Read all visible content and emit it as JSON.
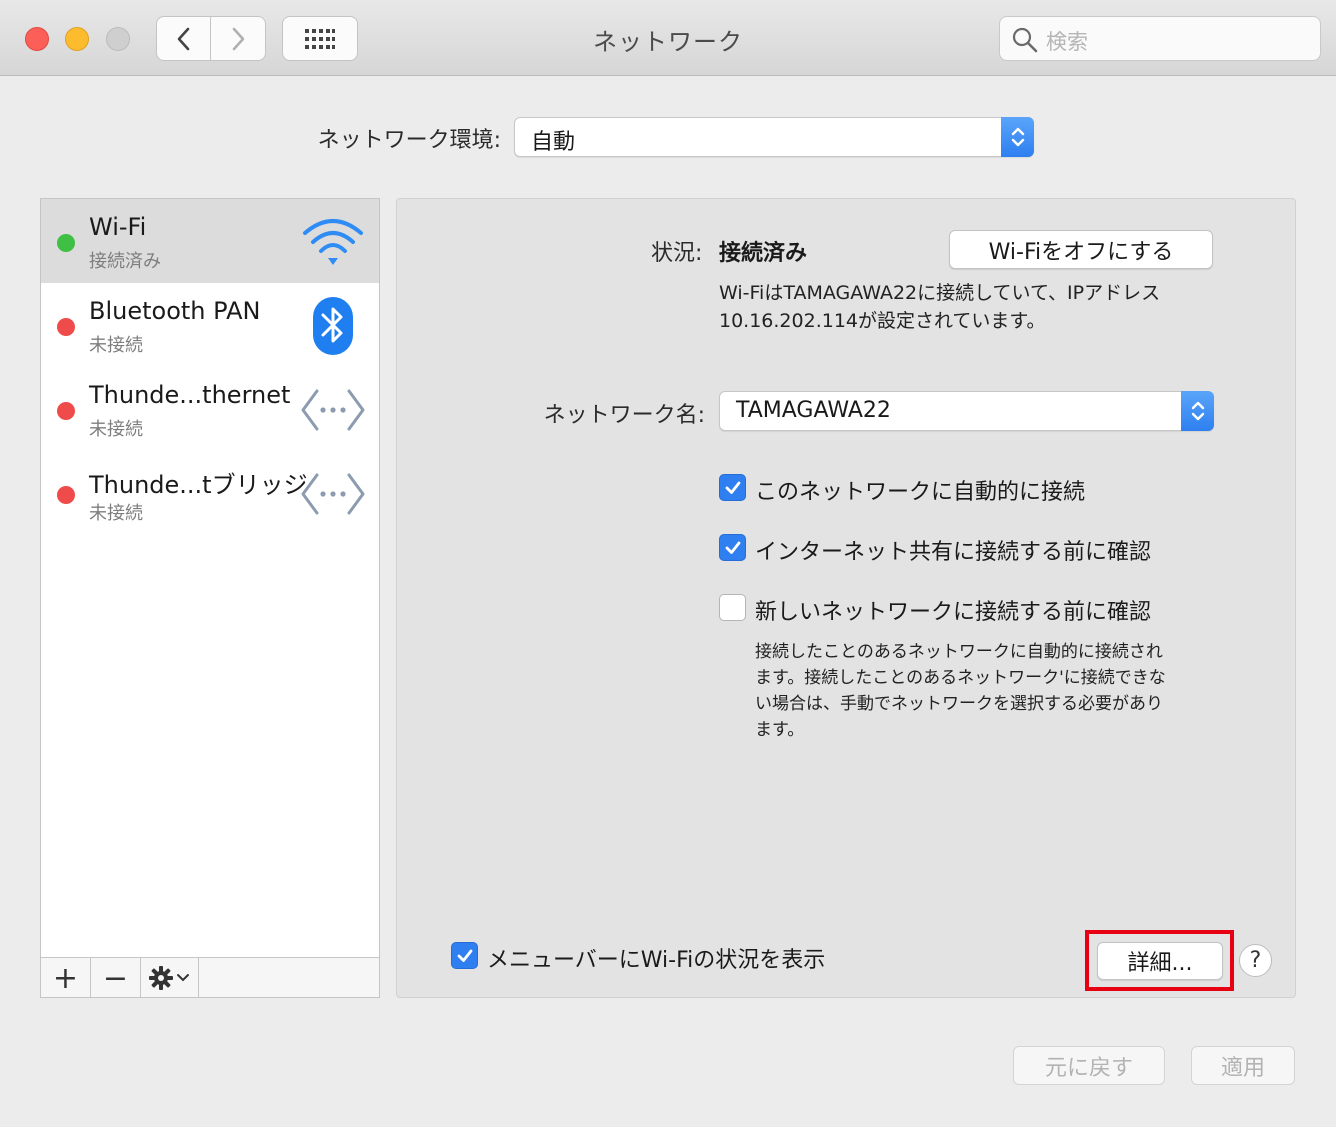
{
  "window": {
    "title": "ネットワーク"
  },
  "search": {
    "placeholder": "検索"
  },
  "location": {
    "label": "ネットワーク環境:",
    "value": "自動"
  },
  "services": [
    {
      "name": "Wi-Fi",
      "status": "接続済み",
      "status_color": "#3fbf43",
      "icon": "wifi-icon",
      "selected": true
    },
    {
      "name": "Bluetooth PAN",
      "status": "未接続",
      "status_color": "#f04b4b",
      "icon": "bluetooth-icon",
      "selected": false
    },
    {
      "name": "Thunde...thernet",
      "status": "未接続",
      "status_color": "#f04b4b",
      "icon": "ethernet-arrows-icon",
      "selected": false
    },
    {
      "name": "Thunde...tブリッジ",
      "status": "未接続",
      "status_color": "#f04b4b",
      "icon": "ethernet-arrows-icon",
      "selected": false
    }
  ],
  "sidebar_tools": {
    "add": "+",
    "remove": "−"
  },
  "detail": {
    "status_label": "状況:",
    "status_value": "接続済み",
    "wifi_off_button": "Wi-Fiをオフにする",
    "description_line1": "Wi-FiはTAMAGAWA22に接続していて、IPアドレス",
    "description_line2": "10.16.202.114が設定されています。",
    "network_name_label": "ネットワーク名:",
    "network_name_value": "TAMAGAWA22",
    "checkboxes": [
      {
        "label": "このネットワークに自動的に接続",
        "checked": true
      },
      {
        "label": "インターネット共有に接続する前に確認",
        "checked": true
      },
      {
        "label": "新しいネットワークに接続する前に確認",
        "checked": false
      }
    ],
    "note_lines": [
      "接続したことのあるネットワークに自動的に接続され",
      "ます。接続したことのあるネットワーク'に接続できな",
      "い場合は、手動でネットワークを選択する必要があり",
      "ます。"
    ],
    "menubar_checkbox": {
      "label": "メニューバーにWi-Fiの状況を表示",
      "checked": true
    },
    "advanced_button": "詳細...",
    "help_button": "?"
  },
  "footer": {
    "revert_button": "元に戻す",
    "apply_button": "適用"
  },
  "colors": {
    "accent": "#2f7ff1",
    "highlight": "#e60012"
  }
}
